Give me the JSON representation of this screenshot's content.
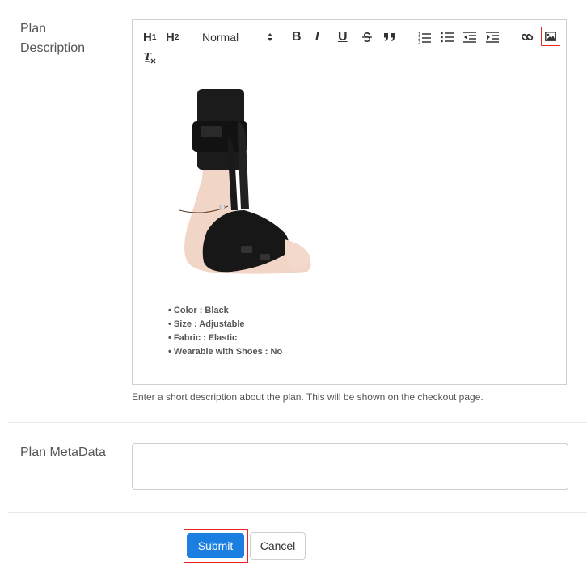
{
  "plan_description": {
    "label": "Plan Description",
    "help_text": "Enter a short description about the plan. This will be shown on the checkout page."
  },
  "toolbar": {
    "h1": "H",
    "h1_sub": "1",
    "h2": "H",
    "h2_sub": "2",
    "format_selected": "Normal",
    "bold": "B",
    "italic": "I",
    "underline": "U"
  },
  "editor_content": {
    "features": [
      "Color : Black",
      "Size : Adjustable",
      "Fabric : Elastic",
      "Wearable with Shoes : No"
    ]
  },
  "plan_metadata": {
    "label": "Plan MetaData",
    "value": ""
  },
  "actions": {
    "submit_label": "Submit",
    "cancel_label": "Cancel"
  },
  "colors": {
    "primary": "#1a7fe0",
    "highlight": "#ee2222",
    "border": "#cfcfcf"
  }
}
